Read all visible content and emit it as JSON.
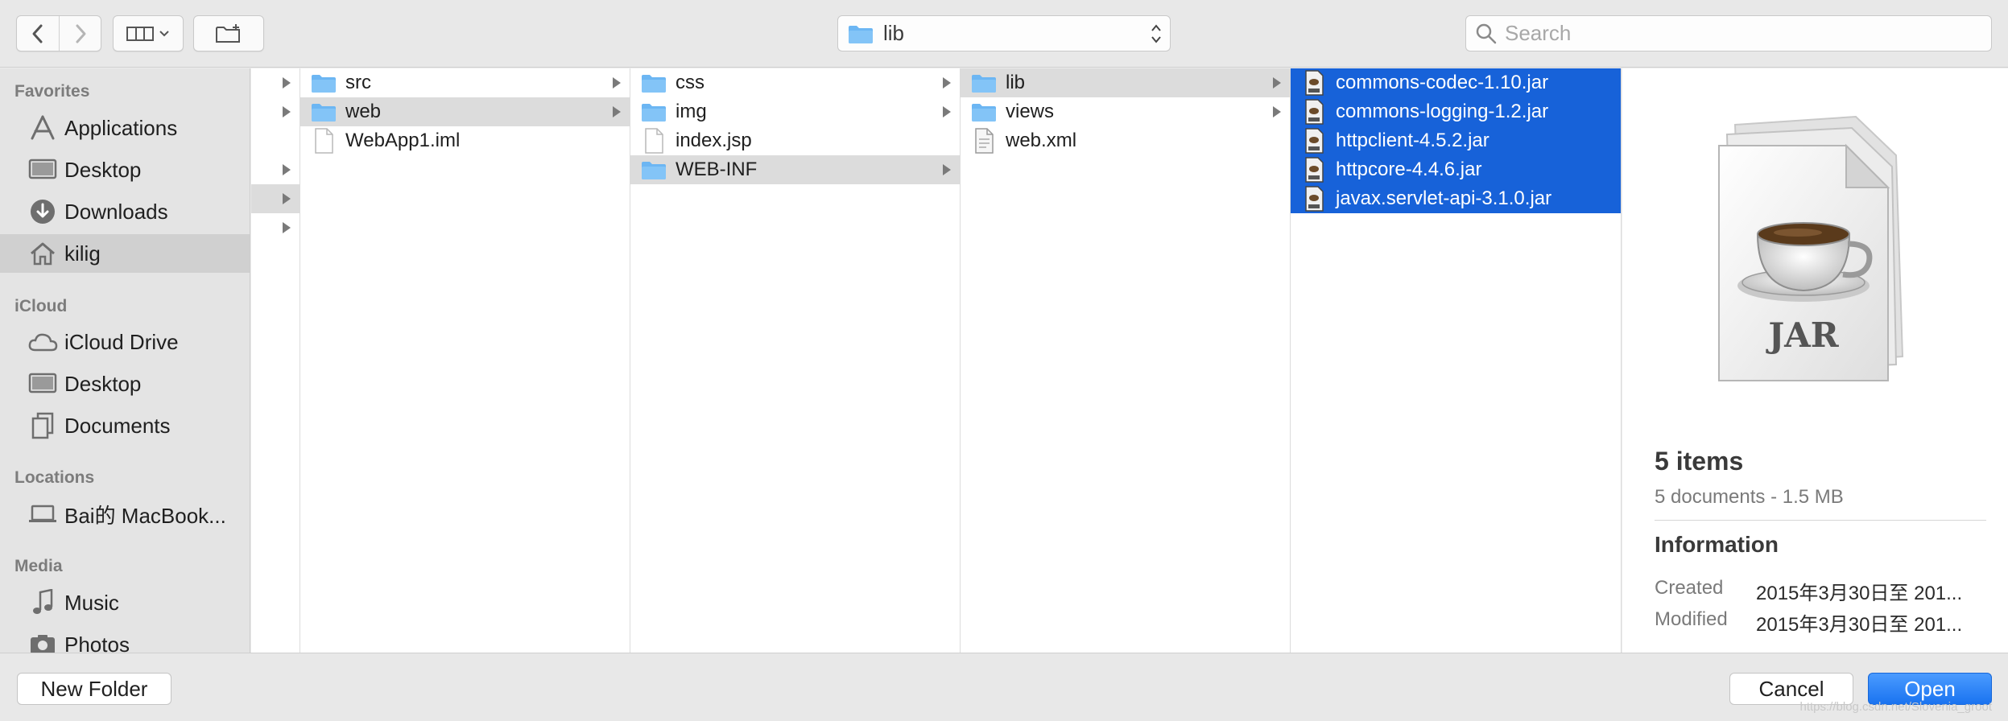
{
  "toolbar": {
    "back_icon": "chevron-left-icon",
    "forward_icon": "chevron-right-icon",
    "view_icon": "column-view-icon",
    "new_folder_icon": "new-folder-icon",
    "path_label": "lib",
    "search_placeholder": "Search",
    "search_value": ""
  },
  "sidebar": {
    "sections": [
      {
        "header": "Favorites",
        "items": [
          {
            "label": "Applications",
            "icon": "applications-icon"
          },
          {
            "label": "Desktop",
            "icon": "desktop-icon"
          },
          {
            "label": "Downloads",
            "icon": "downloads-icon"
          },
          {
            "label": "kilig",
            "icon": "home-icon",
            "selected": true
          }
        ]
      },
      {
        "header": "iCloud",
        "items": [
          {
            "label": "iCloud Drive",
            "icon": "icloud-icon"
          },
          {
            "label": "Desktop",
            "icon": "desktop-icon"
          },
          {
            "label": "Documents",
            "icon": "documents-icon"
          }
        ]
      },
      {
        "header": "Locations",
        "items": [
          {
            "label": "Bai的 MacBook...",
            "icon": "laptop-icon"
          }
        ]
      },
      {
        "header": "Media",
        "items": [
          {
            "label": "Music",
            "icon": "music-icon"
          },
          {
            "label": "Photos",
            "icon": "photos-icon"
          }
        ]
      }
    ]
  },
  "columns": {
    "col1": [
      {
        "label": "src",
        "type": "folder",
        "expandable": true
      },
      {
        "label": "web",
        "type": "folder",
        "expandable": true,
        "path_selected": true
      },
      {
        "label": "WebApp1.iml",
        "type": "file"
      }
    ],
    "col2": [
      {
        "label": "css",
        "type": "folder",
        "expandable": true
      },
      {
        "label": "img",
        "type": "folder",
        "expandable": true
      },
      {
        "label": "index.jsp",
        "type": "file"
      },
      {
        "label": "WEB-INF",
        "type": "folder",
        "expandable": true,
        "path_selected": true
      }
    ],
    "col3": [
      {
        "label": "lib",
        "type": "folder",
        "expandable": true,
        "path_selected": true
      },
      {
        "label": "views",
        "type": "folder",
        "expandable": true
      },
      {
        "label": "web.xml",
        "type": "xml"
      }
    ],
    "col4": [
      {
        "label": "commons-codec-1.10.jar",
        "type": "jar",
        "selected": true
      },
      {
        "label": "commons-logging-1.2.jar",
        "type": "jar",
        "selected": true
      },
      {
        "label": "httpclient-4.5.2.jar",
        "type": "jar",
        "selected": true
      },
      {
        "label": "httpcore-4.4.6.jar",
        "type": "jar",
        "selected": true
      },
      {
        "label": "javax.servlet-api-3.1.0.jar",
        "type": "jar",
        "selected": true
      }
    ]
  },
  "preview": {
    "icon_label": "JAR",
    "title": "5 items",
    "subtitle": "5 documents - 1.5 MB",
    "info_header": "Information",
    "created_label": "Created",
    "created_value": "2015年3月30日至 201...",
    "modified_label": "Modified",
    "modified_value": "2015年3月30日至 201..."
  },
  "footer": {
    "new_folder_label": "New Folder",
    "cancel_label": "Cancel",
    "open_label": "Open",
    "watermark": "https://blog.csdn.net/Slovenia_groot"
  },
  "colors": {
    "selection": "#1762d9",
    "folder": "#6cb6f3",
    "primary_button": "#1a73f0"
  }
}
